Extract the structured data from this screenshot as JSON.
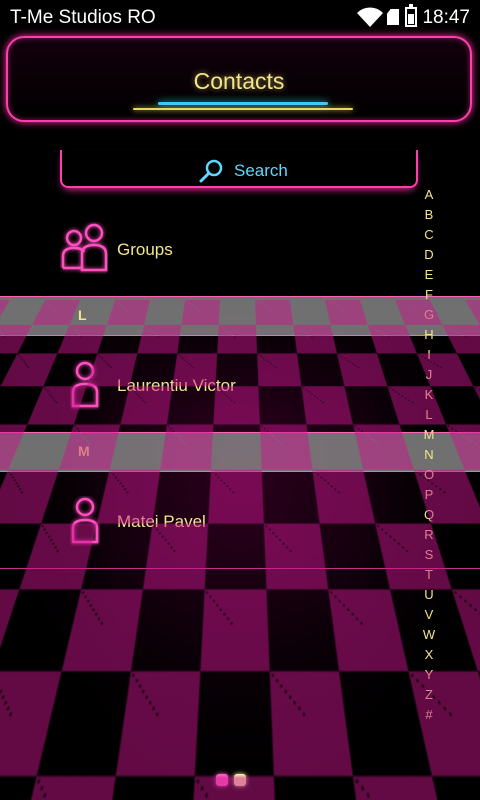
{
  "status_bar": {
    "carrier": "T-Me Studios RO",
    "time": "18:47",
    "icons": [
      "wifi-icon",
      "sim-icon",
      "battery-icon"
    ]
  },
  "header": {
    "title": "Contacts"
  },
  "search": {
    "label": "Search",
    "icon": "magnifier-icon"
  },
  "groups_row": {
    "label": "Groups",
    "icon": "groups-icon"
  },
  "sections": [
    {
      "letter": "L",
      "contacts": [
        {
          "name": "Laurentiu Victor",
          "icon": "person-icon"
        }
      ]
    },
    {
      "letter": "M",
      "contacts": [
        {
          "name": "Matei Pavel",
          "icon": "person-icon"
        }
      ]
    }
  ],
  "alphabet_index": [
    "A",
    "B",
    "C",
    "D",
    "E",
    "F",
    "G",
    "H",
    "I",
    "J",
    "K",
    "L",
    "M",
    "N",
    "O",
    "P",
    "Q",
    "R",
    "S",
    "T",
    "U",
    "V",
    "W",
    "X",
    "Y",
    "Z",
    "#"
  ],
  "page_indicator": {
    "pages": 2,
    "current": 1
  },
  "colors": {
    "neon_pink": "#ff3fb0",
    "text_yellow": "#f2e58a",
    "search_cyan": "#5fd8ff",
    "section_gray": "#969696"
  }
}
